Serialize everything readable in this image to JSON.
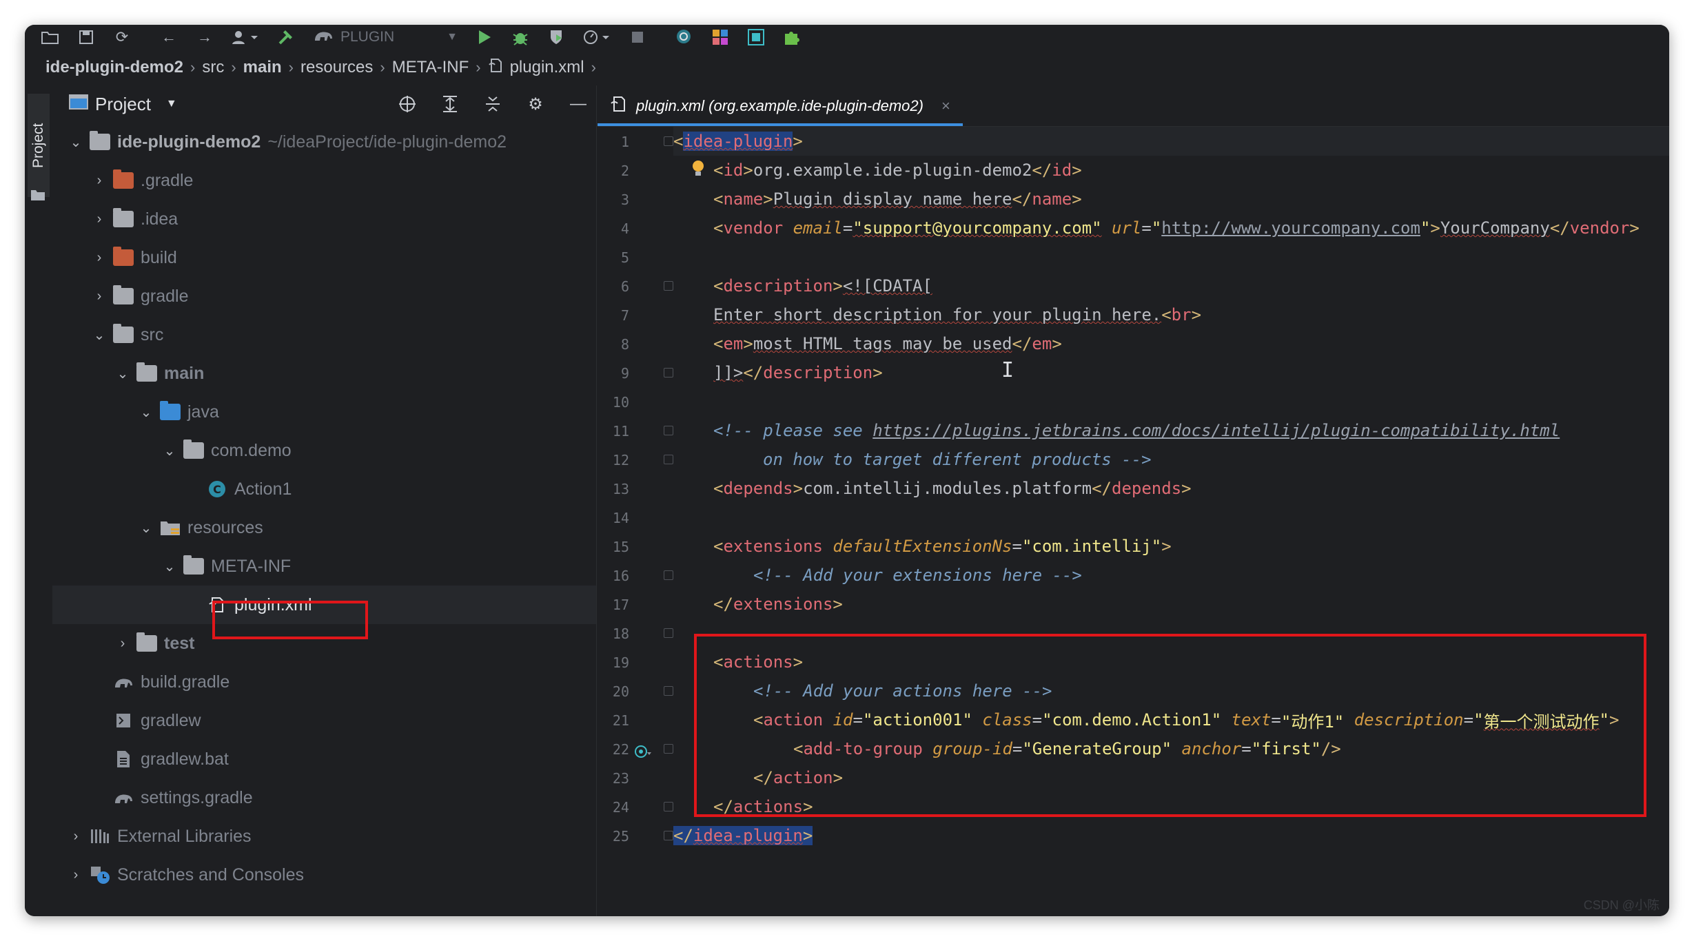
{
  "toolbar": {
    "run_config_label": "PLUGIN"
  },
  "breadcrumb": [
    "ide-plugin-demo2",
    "src",
    "main",
    "resources",
    "META-INF",
    "plugin.xml"
  ],
  "tool_strip": {
    "project_tab": "Project"
  },
  "project_panel": {
    "title": "Project",
    "root_name": "ide-plugin-demo2",
    "root_path": "~/ideaProject/ide-plugin-demo2",
    "items": {
      "gradle_hidden": ".gradle",
      "idea": ".idea",
      "build": "build",
      "gradle": "gradle",
      "src": "src",
      "main": "main",
      "java": "java",
      "com_demo": "com.demo",
      "action1": "Action1",
      "resources": "resources",
      "meta_inf": "META-INF",
      "plugin_xml": "plugin.xml",
      "test": "test",
      "build_gradle": "build.gradle",
      "gradlew": "gradlew",
      "gradlew_bat": "gradlew.bat",
      "settings_gradle": "settings.gradle",
      "external_libraries": "External Libraries",
      "scratches": "Scratches and Consoles"
    }
  },
  "editor": {
    "tab_label": "plugin.xml (org.example.ide-plugin-demo2)",
    "line_numbers": [
      "1",
      "2",
      "3",
      "4",
      "5",
      "6",
      "7",
      "8",
      "9",
      "10",
      "11",
      "12",
      "13",
      "14",
      "15",
      "16",
      "17",
      "18",
      "19",
      "20",
      "21",
      "22",
      "23",
      "24",
      "25"
    ],
    "code": {
      "l1_tag": "idea-plugin",
      "l2_tag": "id",
      "l2_text": "org.example.ide-plugin-demo2",
      "l3_tag": "name",
      "l3_text": "Plugin display name here",
      "l4_tag": "vendor",
      "l4_attr1": "email",
      "l4_val1": "\"support@yourcompany.com\"",
      "l4_attr2": "url",
      "l4_val2_q": "\"",
      "l4_url": "http://www.yourcompany.com",
      "l4_text": "YourCompany",
      "l6_tag": "description",
      "l6_cdata": "<![CDATA[",
      "l7_text": "Enter short description for your plugin here.",
      "l7_tag": "br",
      "l8_tag": "em",
      "l8_text": "most HTML tags may be used",
      "l9_cdata": "]]>",
      "l9_tag": "description",
      "l11_comment": "<!-- please see ",
      "l11_link": "https://plugins.jetbrains.com/docs/intellij/plugin-compatibility.html",
      "l12_comment": "on how to target different products -->",
      "l13_tag": "depends",
      "l13_text": "com.intellij.modules.platform",
      "l15_tag": "extensions",
      "l15_attr": "defaultExtensionNs",
      "l15_val": "\"com.intellij\"",
      "l16_comment": "<!-- Add your extensions here -->",
      "l17_tag": "extensions",
      "l19_tag": "actions",
      "l20_comment": "<!-- Add your actions here -->",
      "l21_tag": "action",
      "l21_attr1": "id",
      "l21_val1": "\"action001\"",
      "l21_attr2": "class",
      "l21_val2": "\"com.demo.Action1\"",
      "l21_attr3": "text",
      "l21_val3": "\"动作1\"",
      "l21_attr4": "description",
      "l21_val4_q1": "\"",
      "l21_val4": "第一个测试动作",
      "l21_val4_q2": "\"",
      "l22_tag": "add-to-group",
      "l22_attr1": "group-id",
      "l22_val1": "\"GenerateGroup\"",
      "l22_attr2": "anchor",
      "l22_val2": "\"first\"",
      "l23_tag": "action",
      "l24_tag": "actions",
      "l25_tag": "idea-plugin"
    }
  },
  "watermark": "CSDN @小陈"
}
